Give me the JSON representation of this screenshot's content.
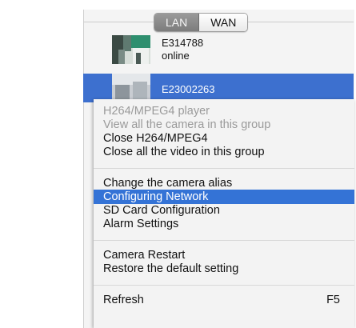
{
  "tabs": {
    "lan": "LAN",
    "wan": "WAN",
    "active": "LAN"
  },
  "devices": [
    {
      "id": "E314788",
      "status": "online",
      "selected": false
    },
    {
      "id": "E23002263",
      "status": "",
      "selected": true
    }
  ],
  "context_menu": {
    "groups": [
      [
        {
          "label": "H264/MPEG4 player",
          "enabled": false
        },
        {
          "label": "View all the camera in this group",
          "enabled": false
        },
        {
          "label": "Close H264/MPEG4",
          "enabled": true
        },
        {
          "label": "Close all the video in this group",
          "enabled": true
        }
      ],
      [
        {
          "label": "Change the camera alias",
          "enabled": true
        },
        {
          "label": "Configuring Network",
          "enabled": true,
          "highlighted": true
        },
        {
          "label": "SD Card Configuration",
          "enabled": true
        },
        {
          "label": "Alarm Settings",
          "enabled": true
        }
      ],
      [
        {
          "label": "Camera Restart",
          "enabled": true
        },
        {
          "label": "Restore the default setting",
          "enabled": true
        }
      ],
      [
        {
          "label": "Refresh",
          "enabled": true,
          "shortcut": "F5"
        }
      ]
    ]
  },
  "colors": {
    "selection": "#3d70cf",
    "menu_highlight": "#3473d6",
    "disabled_text": "#9a9a9a"
  }
}
